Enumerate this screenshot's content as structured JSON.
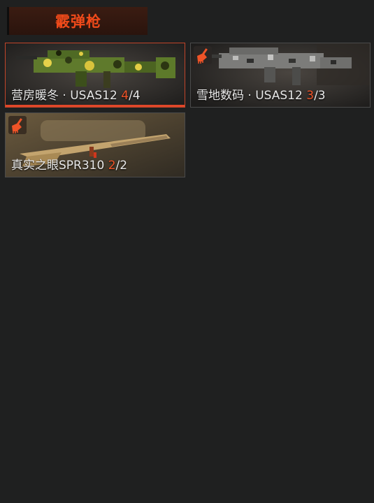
{
  "category": {
    "title": "霰弹枪"
  },
  "skins": [
    {
      "name": "营房暖冬 · USAS12",
      "count_current": "4",
      "count_sep": "/",
      "count_total": "4",
      "selected": true,
      "badge_icon": null
    },
    {
      "name": "雪地数码 · USAS12",
      "count_current": "3",
      "count_sep": "/",
      "count_total": "3",
      "selected": false,
      "badge_icon": "paint-brush-icon"
    },
    {
      "name": "真实之眼SPR310",
      "count_current": "2",
      "count_sep": "/",
      "count_total": "2",
      "selected": false,
      "badge_icon": "paint-brush-icon"
    }
  ],
  "colors": {
    "background": "#1f2020",
    "accent": "#ef5327",
    "header_bg": "#3b1c12",
    "selected_border": "#c2452a"
  }
}
